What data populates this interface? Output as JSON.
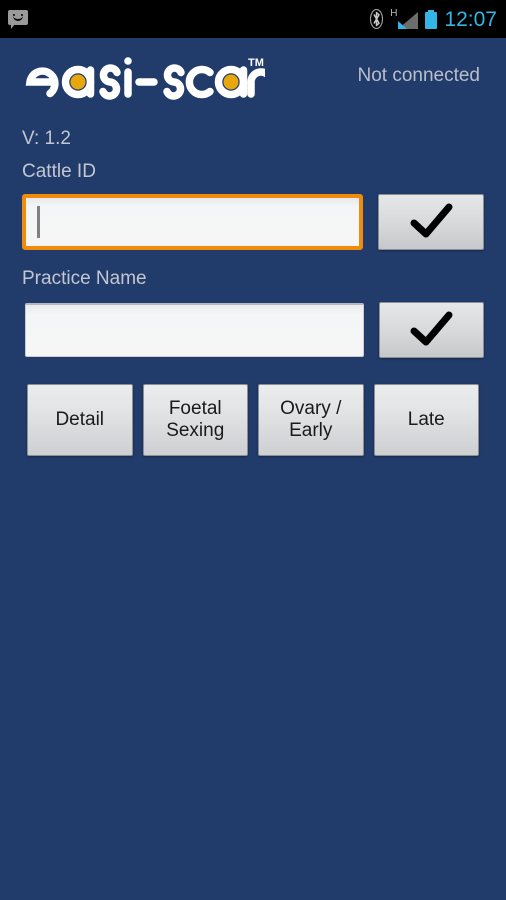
{
  "statusbar": {
    "notification_icon": "sms-message-icon",
    "bluetooth_icon": "bluetooth-icon",
    "network_type": "H",
    "signal_icon": "signal-bars-icon",
    "battery_icon": "battery-full-icon",
    "time": "12:07"
  },
  "header": {
    "logo_text": "easi-scan",
    "logo_trademark": "TM",
    "connection_status": "Not connected"
  },
  "form": {
    "version": "V: 1.2",
    "cattle_id": {
      "label": "Cattle ID",
      "value": "",
      "placeholder": "",
      "confirm_icon": "checkmark-icon"
    },
    "practice_name": {
      "label": "Practice Name",
      "value": "",
      "placeholder": "",
      "confirm_icon": "checkmark-icon"
    }
  },
  "actions": [
    {
      "label": "Detail"
    },
    {
      "label": "Foetal\nSexing"
    },
    {
      "label": "Ovary /\nEarly"
    },
    {
      "label": "Late"
    }
  ],
  "colors": {
    "background": "#213C6B",
    "accent_orange": "#F28A0C",
    "logo_dot": "#E8A80C",
    "status_accent": "#33b5e5",
    "label_text": "#c2c7d1"
  }
}
